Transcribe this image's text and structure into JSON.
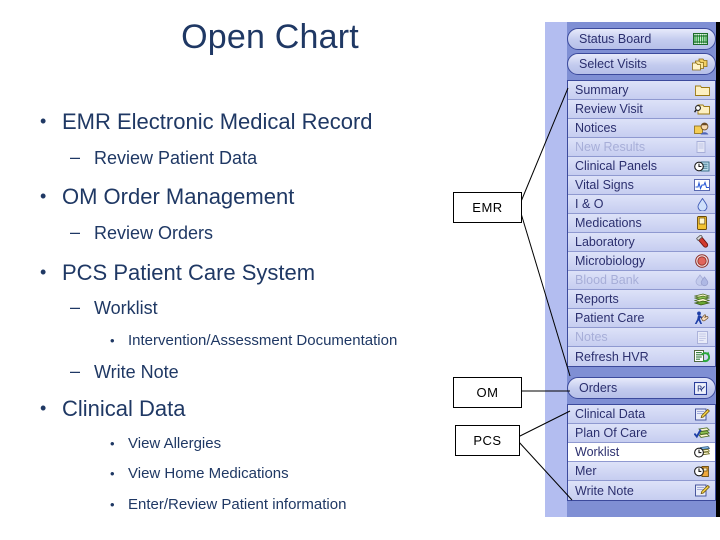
{
  "slide": {
    "title": "Open Chart",
    "outline": [
      {
        "level": 1,
        "text": "EMR Electronic Medical Record"
      },
      {
        "level": 2,
        "text": "Review Patient Data"
      },
      {
        "level": 1,
        "text": "OM Order Management"
      },
      {
        "level": 2,
        "text": "Review Orders"
      },
      {
        "level": 1,
        "text": "PCS Patient Care System"
      },
      {
        "level": 2,
        "text": "Worklist"
      },
      {
        "level": 3,
        "text": "Intervention/Assessment Documentation"
      },
      {
        "level": 2,
        "text": "Write Note"
      },
      {
        "level": 1,
        "text": "Clinical Data"
      },
      {
        "level": 3,
        "text": "View Allergies"
      },
      {
        "level": 3,
        "text": "View Home Medications"
      },
      {
        "level": 3,
        "text": "Enter/Review Patient information"
      }
    ],
    "bullets": {
      "level1": "•",
      "level2": "–",
      "level3": "•"
    },
    "colors": {
      "text": "#1F3864",
      "callout_border": "#000000",
      "panel_bar": "#7f8fd4",
      "panel_strip": "#b3bdf0"
    }
  },
  "callouts": [
    {
      "id": "emr",
      "label": "EMR"
    },
    {
      "id": "om",
      "label": "OM"
    },
    {
      "id": "pcs",
      "label": "PCS"
    }
  ],
  "menu": {
    "top_buttons": [
      {
        "label": "Status Board",
        "icon": "green-grid-icon",
        "enabled": true
      },
      {
        "label": "Select Visits",
        "icon": "stacked-folders-icon",
        "enabled": true
      }
    ],
    "emr_group": [
      {
        "label": "Summary",
        "icon": "folder-icon",
        "enabled": true,
        "selected": false
      },
      {
        "label": "Review Visit",
        "icon": "folder-search-icon",
        "enabled": true,
        "selected": false
      },
      {
        "label": "Notices",
        "icon": "person-notice-icon",
        "enabled": true,
        "selected": false
      },
      {
        "label": "New Results",
        "icon": "new-results-icon",
        "enabled": false,
        "selected": false
      },
      {
        "label": "Clinical Panels",
        "icon": "clock-panel-icon",
        "enabled": true,
        "selected": false
      },
      {
        "label": "Vital Signs",
        "icon": "vitals-chart-icon",
        "enabled": true,
        "selected": false
      },
      {
        "label": "I & O",
        "icon": "droplet-icon",
        "enabled": true,
        "selected": false
      },
      {
        "label": "Medications",
        "icon": "pill-box-icon",
        "enabled": true,
        "selected": false
      },
      {
        "label": "Laboratory",
        "icon": "test-tube-icon",
        "enabled": true,
        "selected": false
      },
      {
        "label": "Microbiology",
        "icon": "petri-dish-icon",
        "enabled": true,
        "selected": false
      },
      {
        "label": "Blood Bank",
        "icon": "blood-drop-icon",
        "enabled": false,
        "selected": false
      },
      {
        "label": "Reports",
        "icon": "green-book-icon",
        "enabled": true,
        "selected": false
      },
      {
        "label": "Patient Care",
        "icon": "patient-care-icon",
        "enabled": true,
        "selected": false
      },
      {
        "label": "Notes",
        "icon": "notebook-icon",
        "enabled": false,
        "selected": false
      },
      {
        "label": "Refresh HVR",
        "icon": "refresh-icon",
        "enabled": true,
        "selected": false
      }
    ],
    "orders_button": {
      "label": "Orders",
      "icon": "orders-icon",
      "enabled": true
    },
    "pcs_group": [
      {
        "label": "Clinical Data",
        "icon": "clinical-data-icon",
        "enabled": true,
        "selected": false
      },
      {
        "label": "Plan Of Care",
        "icon": "plan-of-care-icon",
        "enabled": true,
        "selected": false
      },
      {
        "label": "Worklist",
        "icon": "worklist-clock-icon",
        "enabled": true,
        "selected": true
      },
      {
        "label": "Mer",
        "icon": "mer-icon",
        "enabled": true,
        "selected": false
      },
      {
        "label": "Write Note",
        "icon": "write-note-icon",
        "enabled": true,
        "selected": false
      }
    ]
  }
}
